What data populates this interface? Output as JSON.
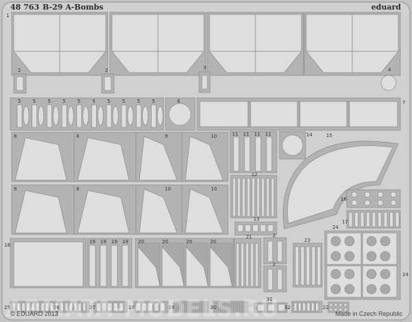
{
  "header": {
    "catalog_number": "48 763",
    "title": "B-29 A-Bombs",
    "brand": "eduard"
  },
  "footer": {
    "copyright": "© EDUARD 2013",
    "origin": "Made in Czech Republic",
    "watermark": "ARMATA-MODELS.RU"
  },
  "part_labels": [
    "1",
    "2",
    "3",
    "4",
    "5",
    "6",
    "7",
    "8",
    "9",
    "10",
    "11",
    "12",
    "13",
    "14",
    "15",
    "16",
    "17",
    "18",
    "19",
    "20",
    "21",
    "22",
    "23",
    "24",
    "25",
    "26",
    "27",
    "28",
    "29",
    "30",
    "31",
    "32"
  ],
  "colors": {
    "fret": "#c4c4c4",
    "part": "#dedede",
    "frame": "#b3b3b3",
    "outline": "#8a8a8a"
  }
}
